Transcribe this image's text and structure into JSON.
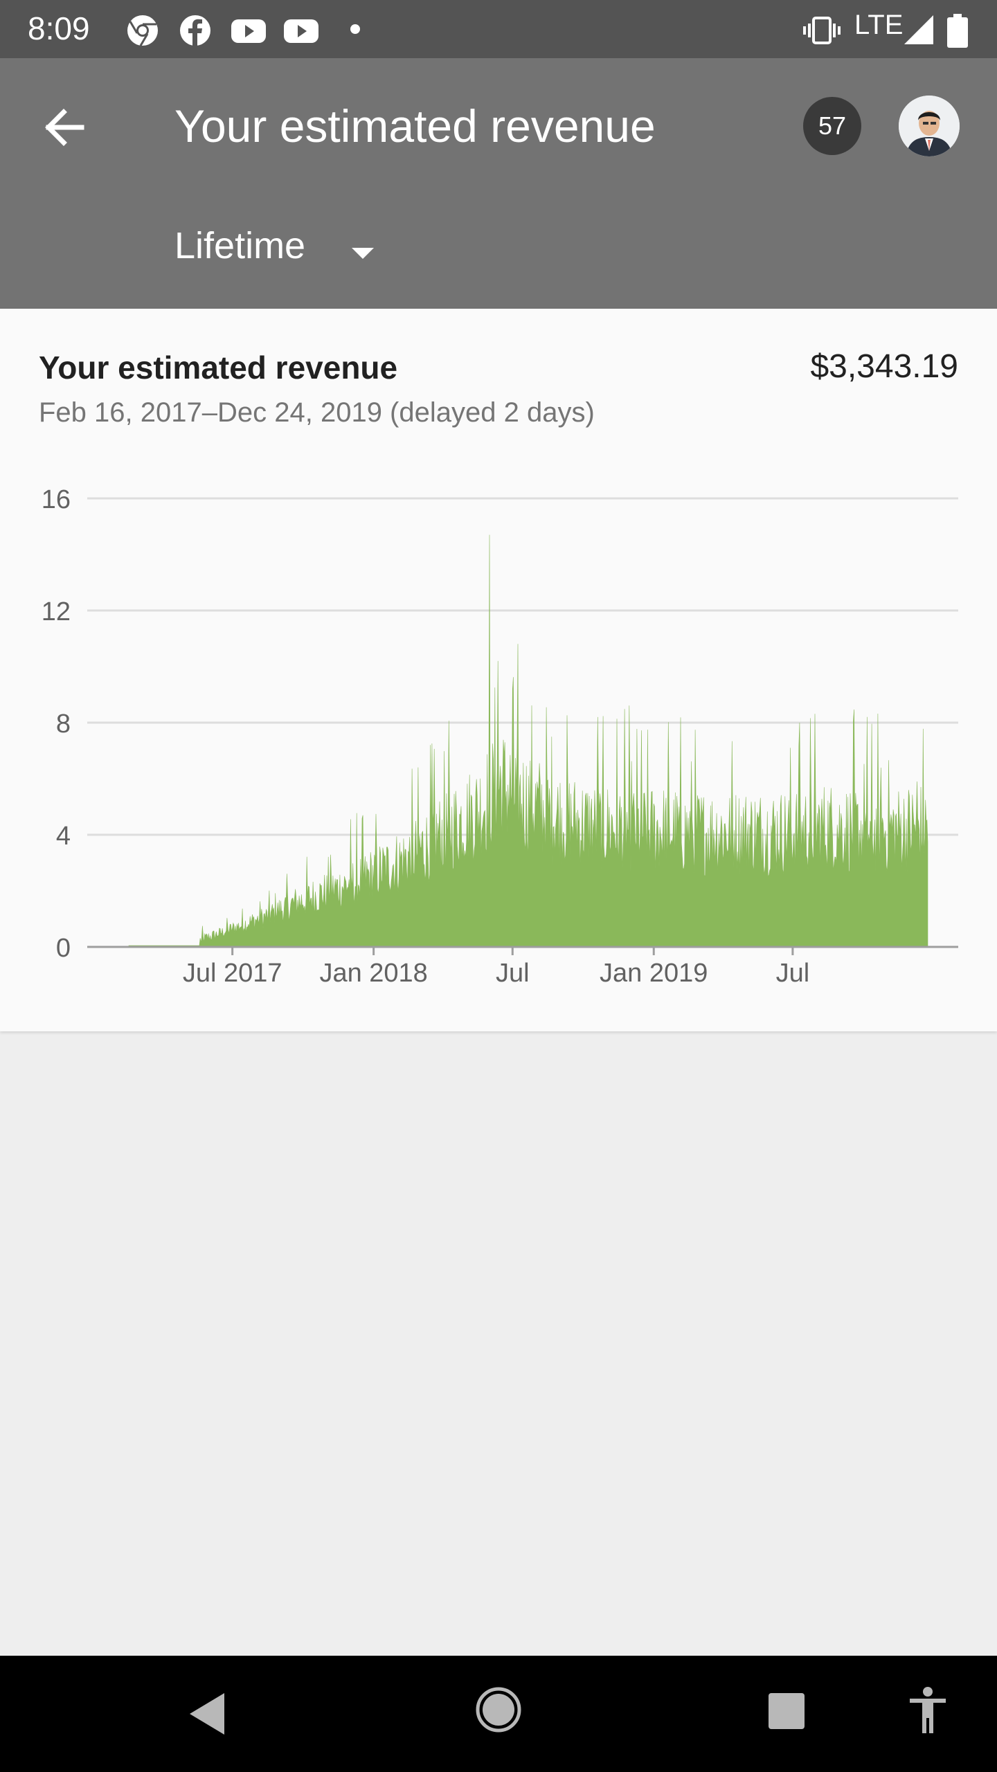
{
  "status_bar": {
    "time": "8:09",
    "network": "LTE",
    "left_icons": [
      "chrome-icon",
      "facebook-icon",
      "youtube-icon",
      "youtube-icon",
      "notification-dot-icon"
    ],
    "right_icons": [
      "vibrate-icon",
      "signal-icon",
      "battery-icon"
    ]
  },
  "app_bar": {
    "title": "Your estimated revenue",
    "notification_count": "57",
    "period": "Lifetime",
    "background": "#737373"
  },
  "card": {
    "title": "Your estimated revenue",
    "total": "$3,343.19",
    "date_range": "Feb 16, 2017–Dec 24, 2019 (delayed 2 days)"
  },
  "chart_data": {
    "type": "area",
    "title": "",
    "xlabel": "",
    "ylabel": "",
    "x_range": [
      "2017-02-16",
      "2019-12-24"
    ],
    "ylim": [
      0,
      16
    ],
    "y_ticks": [
      "16",
      "12",
      "8",
      "4",
      "0"
    ],
    "x_ticks": [
      "Jul 2017",
      "Jan 2018",
      "Jul",
      "Jan 2019",
      "Jul"
    ],
    "grid": true,
    "color": "#8ab85a",
    "series": [
      {
        "x": [
          "2017-02",
          "2017-03",
          "2017-04",
          "2017-05",
          "2017-06",
          "2017-07",
          "2017-08",
          "2017-09",
          "2017-10",
          "2017-11",
          "2017-12",
          "2018-01",
          "2018-02",
          "2018-03",
          "2018-04",
          "2018-05",
          "2018-06",
          "2018-07",
          "2018-08",
          "2018-09",
          "2018-10",
          "2018-11",
          "2018-12",
          "2019-01",
          "2019-02",
          "2019-03",
          "2019-04",
          "2019-05",
          "2019-06",
          "2019-07",
          "2019-08",
          "2019-09",
          "2019-10",
          "2019-11",
          "2019-12"
        ],
        "values": [
          0.05,
          0.05,
          0.05,
          0.2,
          0.5,
          0.8,
          1.1,
          1.5,
          1.8,
          2.1,
          2.4,
          2.8,
          3.2,
          3.7,
          4.3,
          4.8,
          5.8,
          5.2,
          4.8,
          4.5,
          4.3,
          4.3,
          4.2,
          4.2,
          4.1,
          4.1,
          4.1,
          4.1,
          4.1,
          4.2,
          4.3,
          4.2,
          4.1,
          4.2,
          4.3
        ],
        "peaks": [
          {
            "x": "2018-06-01",
            "y": 14.7
          },
          {
            "x": "2018-06-12",
            "y": 10.2
          },
          {
            "x": "2018-07-01",
            "y": 9.2
          },
          {
            "x": "2018-10-20",
            "y": 8.2
          },
          {
            "x": "2019-07-10",
            "y": 8.0
          },
          {
            "x": "2019-12-10",
            "y": 5.9
          }
        ]
      }
    ]
  }
}
